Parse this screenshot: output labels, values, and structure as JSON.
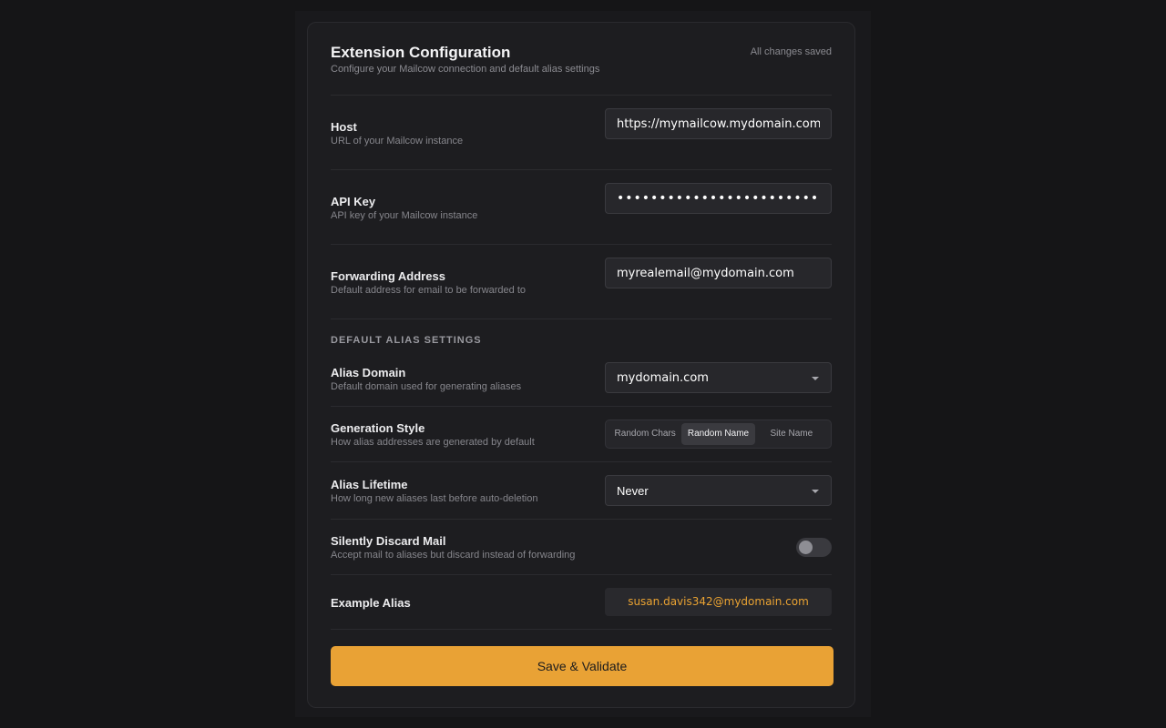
{
  "header": {
    "title": "Extension Configuration",
    "subtitle": "Configure your Mailcow connection and default alias settings",
    "status": "All changes saved"
  },
  "connection": {
    "host": {
      "label": "Host",
      "description": "URL of your Mailcow instance",
      "value": "https://mymailcow.mydomain.com"
    },
    "api_key": {
      "label": "API Key",
      "description": "API key of your Mailcow instance",
      "value": "xxxxxxxxxxxxxxxxxxxxxxxxxxxxxxxxxxxx"
    },
    "forwarding": {
      "label": "Forwarding Address",
      "description": "Default address for email to be forwarded to",
      "value": "myrealemail@mydomain.com"
    }
  },
  "alias_settings": {
    "heading": "DEFAULT ALIAS SETTINGS",
    "domain": {
      "label": "Alias Domain",
      "description": "Default domain used for generating aliases",
      "selected": "mydomain.com"
    },
    "generation_style": {
      "label": "Generation Style",
      "description": "How alias addresses are generated by default",
      "options": [
        "Random Chars",
        "Random Name",
        "Site Name"
      ],
      "selected_index": 1
    },
    "lifetime": {
      "label": "Alias Lifetime",
      "description": "How long new aliases last before auto-deletion",
      "selected": "Never"
    },
    "discard": {
      "label": "Silently Discard Mail",
      "description": "Accept mail to aliases but discard instead of forwarding",
      "enabled": false
    },
    "example": {
      "label": "Example Alias",
      "value": "susan.davis342@mydomain.com"
    }
  },
  "actions": {
    "save_label": "Save & Validate"
  },
  "colors": {
    "accent": "#e9a235",
    "background": "#151517",
    "card": "#1d1d20"
  },
  "icons": {
    "select_caret": "chevron-down-icon"
  }
}
